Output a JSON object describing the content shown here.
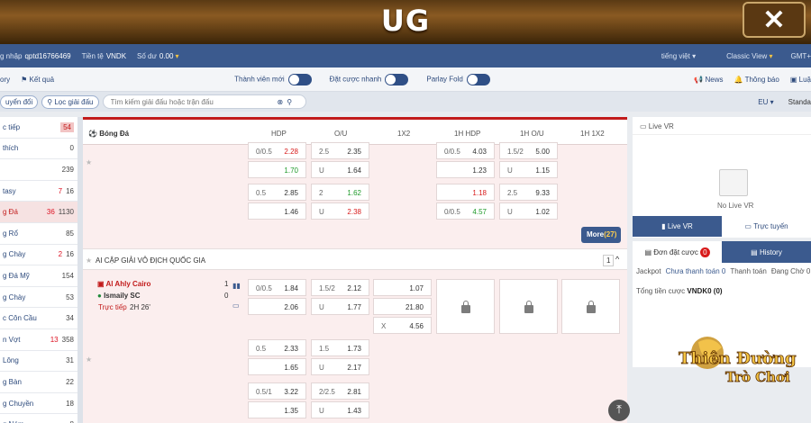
{
  "brand": {
    "logo": "UG",
    "close_glyph": "✕"
  },
  "account": {
    "login_label": "g nhập",
    "username": "qptd16766469",
    "currency_label": "Tiền tệ",
    "currency": "VNDK",
    "balance_label": "Số dư",
    "balance": "0.00",
    "language": "tiếng việt",
    "view": "Classic View",
    "timezone": "GMT+"
  },
  "nav": {
    "history": "ory",
    "results": "Kết quả",
    "new_member": "Thành viên mới",
    "quick_bet": "Đặt cược nhanh",
    "parlay_fold": "Parlay Fold",
    "news": "News",
    "announcement": "Thông báo",
    "more": "Luậ"
  },
  "filter": {
    "convert": "uyển đổi",
    "league_filter": "Lọc giải đấu",
    "search_placeholder": "Tìm kiếm giải đấu hoặc trận đấu",
    "odds_format": "EU",
    "standard": "Standa"
  },
  "sidebar": {
    "items": [
      {
        "label": "c tiếp",
        "count": "54",
        "badge": true
      },
      {
        "label": "thích",
        "count": "0"
      },
      {
        "label": "",
        "count": "239"
      },
      {
        "label": "tasy",
        "live": "7",
        "count": "16"
      },
      {
        "label": "g Đá",
        "live": "36",
        "count": "1130",
        "active": true
      },
      {
        "label": "g Rổ",
        "count": "85"
      },
      {
        "label": "g Chày",
        "live": "2",
        "count": "16"
      },
      {
        "label": "g Đá Mỹ",
        "count": "154"
      },
      {
        "label": "g Chày",
        "count": "53"
      },
      {
        "label": "c Côn Cầu",
        "count": "34"
      },
      {
        "label": "n Vợt",
        "live": "13",
        "count": "358"
      },
      {
        "label": "Lông",
        "count": "31"
      },
      {
        "label": "g Bàn",
        "count": "22"
      },
      {
        "label": "g Chuyền",
        "count": "18"
      },
      {
        "label": "g Ném",
        "count": "8"
      }
    ]
  },
  "odds": {
    "sport": "Bóng Đá",
    "columns": [
      "HDP",
      "O/U",
      "1X2",
      "1H HDP",
      "1H O/U",
      "1H 1X2"
    ],
    "more_label": "More",
    "more_count": "(27)",
    "league": "AI CẬP GIẢI VÔ ĐỊCH QUỐC GIA",
    "league_count": "1",
    "match": {
      "home": "Al Ahly Cairo",
      "away": "Ismaily SC",
      "home_score": "1",
      "away_score": "0",
      "status": "Trực tiếp",
      "time": "2H 26'"
    },
    "cells": {
      "a1l": "0/0.5",
      "a1r": "2.28",
      "a2r": "1.70",
      "a3l": "2.5",
      "a3r": "2.35",
      "a4l": "U",
      "a4r": "1.64",
      "a5l": "0/0.5",
      "a5r": "4.03",
      "a6r": "1.23",
      "a7l": "1.5/2",
      "a7r": "5.00",
      "a8l": "U",
      "a8r": "1.15",
      "b1l": "0.5",
      "b1r": "2.85",
      "b2r": "1.46",
      "b3l": "2",
      "b3r": "1.62",
      "b4l": "U",
      "b4r": "2.38",
      "b5r": "1.18",
      "b6l": "0/0.5",
      "b6r": "4.57",
      "b7l": "2.5",
      "b7r": "9.33",
      "b8l": "U",
      "b8r": "1.02",
      "c1l": "0/0.5",
      "c1r": "1.84",
      "c2r": "2.06",
      "c3l": "1.5/2",
      "c3r": "2.12",
      "c4l": "U",
      "c4r": "1.77",
      "c5r": "1.07",
      "c6r": "21.80",
      "c7l": "X",
      "c7r": "4.56",
      "d1l": "0.5",
      "d1r": "2.33",
      "d2r": "1.65",
      "d3l": "1.5",
      "d3r": "1.73",
      "d4l": "U",
      "d4r": "2.17",
      "e1l": "0.5/1",
      "e1r": "3.22",
      "e2r": "1.35",
      "e3l": "2/2.5",
      "e3r": "2.81",
      "e4l": "U",
      "e4r": "1.43"
    }
  },
  "right": {
    "live_vr": "Live VR",
    "no_live": "No Live VR",
    "tab_live_vr": "Live VR",
    "tab_live": "Trực tuyến",
    "tab_bets": "Đơn đặt cược",
    "bets_count": "0",
    "tab_history": "History",
    "sub": [
      "Jackpot",
      "Chưa thanh toán 0",
      "Thanh toán",
      "Đang Chờ 0"
    ],
    "total_label": "Tổng tiền cược",
    "total_value": "VNDK0",
    "total_extra": "(0)"
  },
  "watermark": {
    "line1": "Thiên Đường",
    "line2": "Trò Chơi"
  },
  "colors": {
    "brand_blue": "#3b5a8e",
    "accent_red": "#c21b1b",
    "odds_green": "#1f9a2a",
    "panel_pink": "#fbeeee"
  }
}
